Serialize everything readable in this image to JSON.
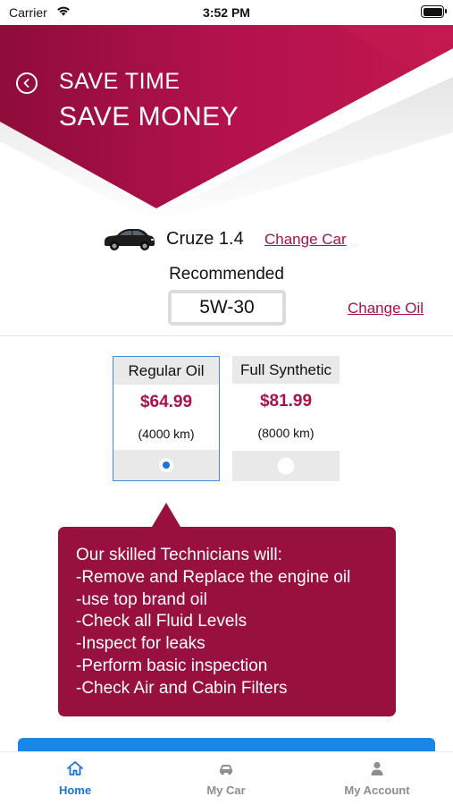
{
  "status_bar": {
    "carrier": "Carrier",
    "time": "3:52 PM"
  },
  "banner": {
    "line1": "SAVE TIME",
    "line2": "SAVE MONEY",
    "color": "#a8124a"
  },
  "vehicle": {
    "name": "Cruze 1.4",
    "change_label": "Change Car"
  },
  "oil": {
    "recommended_label": "Recommended",
    "grade": "5W-30",
    "change_label": "Change Oil"
  },
  "options": [
    {
      "name": "Regular Oil",
      "price": "$64.99",
      "interval": "(4000 km)",
      "selected": true
    },
    {
      "name": "Full Synthetic",
      "price": "$81.99",
      "interval": "(8000 km)",
      "selected": false
    }
  ],
  "info": {
    "lines": [
      "Our skilled Technicians will:",
      "-Remove and Replace the engine oil",
      "-use top brand oil",
      "-Check all Fluid Levels",
      "-Inspect for leaks",
      "-Perform basic inspection",
      "-Check Air and Cabin Filters"
    ]
  },
  "tabs": [
    {
      "label": "Home",
      "icon": "home-icon",
      "active": true
    },
    {
      "label": "My Car",
      "icon": "car-icon",
      "active": false
    },
    {
      "label": "My Account",
      "icon": "person-icon",
      "active": false
    }
  ],
  "colors": {
    "accent": "#a8124a",
    "bubble": "#98103d",
    "selection": "#1a73d9",
    "button": "#1a86e8"
  }
}
